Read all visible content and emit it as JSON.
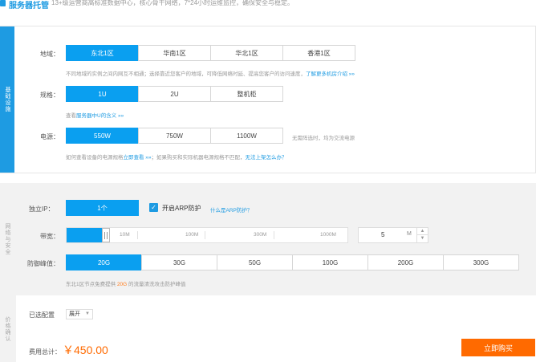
{
  "header": {
    "title": "服务器托管",
    "desc": "13+级运营商高标准数据中心，核心骨干网络，7*24小时运维监控，确保安全与稳定。"
  },
  "basic": {
    "side_label": "基础设施",
    "region": {
      "label": "地域：",
      "options": [
        "东北1区",
        "华南1区",
        "华北1区",
        "香港1区"
      ],
      "selected": "东北1区",
      "note": "不同地域的实例之间内网互不相通；选择靠近您客户的地域，可降低网络时延、提高您客户的访问速度，",
      "note_link": "了解更多机房介绍 »»"
    },
    "spec": {
      "label": "规格：",
      "options": [
        "1U",
        "2U",
        "整机柜"
      ],
      "selected": "1U",
      "note": "查看",
      "note_link": "服务器中U的含义 »»"
    },
    "power": {
      "label": "电源：",
      "options": [
        "550W",
        "750W",
        "1100W"
      ],
      "selected": "550W",
      "side_note": "无需阵选时，均为交流电源",
      "note": "如何查看设备的电源规格",
      "note_link1": "立即查看 »»",
      "note_mid": "；如果购买和实际机器电源规格不匹配，",
      "note_link2": "无法上架怎么办？"
    }
  },
  "network": {
    "side_label": "网络与安全",
    "ip": {
      "label": "独立IP：",
      "options": [
        "1个"
      ],
      "selected": "1个",
      "checkbox_label": "开启ARP防护",
      "checkbox_checked": true,
      "help_link": "什么是ARP防护？"
    },
    "bandwidth": {
      "label": "带宽：",
      "ticks": [
        "10M",
        "100M",
        "300M",
        "1000M"
      ],
      "value": "5",
      "unit": "M",
      "level": 0.005
    },
    "ddos": {
      "label": "防御峰值：",
      "options": [
        "20G",
        "30G",
        "50G",
        "100G",
        "200G",
        "300G"
      ],
      "selected": "20G",
      "note_pre": "东北1区节点免费提供",
      "note_hl": "20G",
      "note_post": "的流量清洗攻击防护峰值"
    }
  },
  "summary": {
    "side_label": "价格确认",
    "config_label": "已选配置",
    "dropdown_value": "展开",
    "price_label": "费用总计：",
    "price": "￥450.00",
    "buy_label": "立即购买"
  },
  "colors": {
    "accent": "#1e9be2",
    "active": "#0a9ff0",
    "orange": "#ff6a00"
  }
}
